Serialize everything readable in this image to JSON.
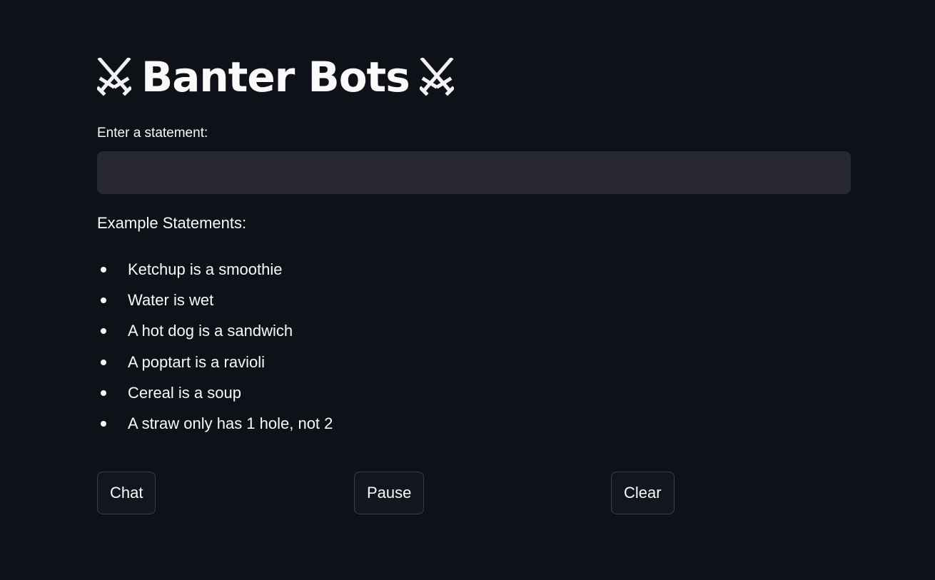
{
  "header": {
    "title": "Banter Bots",
    "left_icon": "crossed-swords-icon",
    "right_icon": "crossed-swords-icon"
  },
  "statement_input": {
    "label": "Enter a statement:",
    "value": "",
    "placeholder": ""
  },
  "examples": {
    "heading": "Example Statements:",
    "items": [
      "Ketchup is a smoothie",
      "Water is wet",
      "A hot dog is a sandwich",
      "A poptart is a ravioli",
      "Cereal is a soup",
      "A straw only has 1 hole, not 2"
    ]
  },
  "buttons": {
    "chat": "Chat",
    "pause": "Pause",
    "clear": "Clear"
  },
  "colors": {
    "background": "#0e1117",
    "input_background": "#262730",
    "text": "#fafafa",
    "button_border": "#3b3e48"
  }
}
